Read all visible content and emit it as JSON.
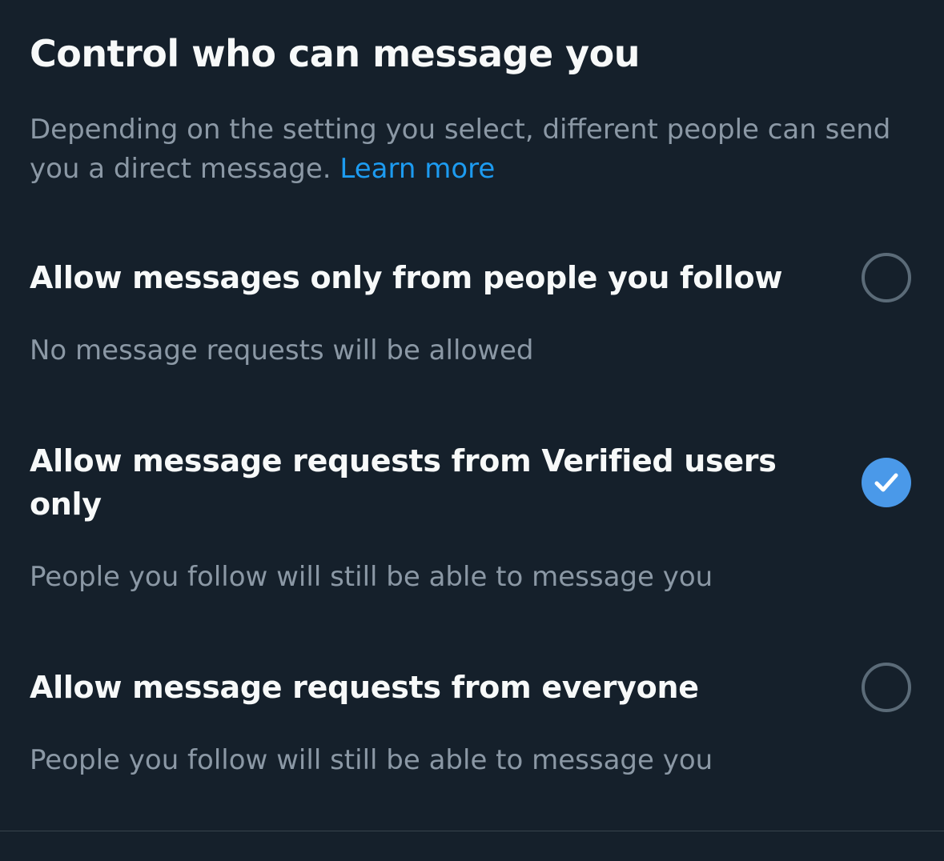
{
  "header": {
    "title": "Control who can message you",
    "description": "Depending on the setting you select, different people can send you a direct message.",
    "learn_more": "Learn more"
  },
  "options": [
    {
      "label": "Allow messages only from people you follow",
      "sublabel": "No message requests will be allowed",
      "selected": false
    },
    {
      "label": "Allow message requests from Verified users only",
      "sublabel": "People you follow will still be able to message you",
      "selected": true
    },
    {
      "label": "Allow message requests from everyone",
      "sublabel": "People you follow will still be able to message you",
      "selected": false
    }
  ],
  "colors": {
    "background": "#15202B",
    "accent": "#1D9BF0",
    "radio_selected": "#4A99E9",
    "radio_unselected_border": "#5B6B78",
    "secondary_text": "#8B98A5"
  }
}
